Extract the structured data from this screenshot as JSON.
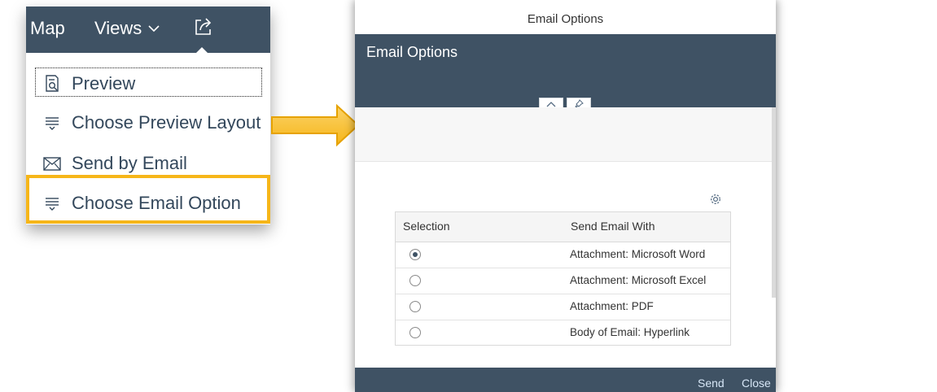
{
  "topbar": {
    "map_label": "Map",
    "views_label": "Views"
  },
  "menu": {
    "items": [
      {
        "label": "Preview",
        "icon": "preview-icon"
      },
      {
        "label": "Choose Preview Layout",
        "icon": "list-layout-icon"
      },
      {
        "label": "Send by Email",
        "icon": "email-icon"
      },
      {
        "label": "Choose Email Option",
        "icon": "list-layout-icon"
      }
    ],
    "highlight_color": "#f6b619"
  },
  "dialog": {
    "title": "Email Options",
    "header_title": "Email Options",
    "table": {
      "columns": [
        "Selection",
        "Send Email With"
      ],
      "rows": [
        {
          "selected": true,
          "value": "Attachment: Microsoft Word"
        },
        {
          "selected": false,
          "value": "Attachment: Microsoft Excel"
        },
        {
          "selected": false,
          "value": "Attachment: PDF"
        },
        {
          "selected": false,
          "value": "Body of Email: Hyperlink"
        }
      ]
    },
    "footer": {
      "send_label": "Send",
      "close_label": "Close"
    }
  },
  "colors": {
    "shell": "#3f5264",
    "menu_text": "#33475b",
    "arrow": "#f6b619"
  }
}
